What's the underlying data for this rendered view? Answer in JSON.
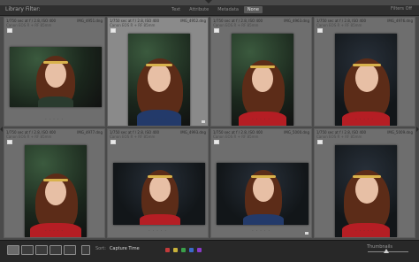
{
  "filter_bar": {
    "title": "Library Filter:",
    "tabs": [
      "Text",
      "Attribute",
      "Metadata",
      "None"
    ],
    "active_tab": "None",
    "right_label": "Filters Off"
  },
  "grid": {
    "cells": [
      {
        "meta": "1/750 sec at f / 2.8, ISO 400",
        "file": "IMG_4951.dng",
        "sub": "Canon EOS R + RF 85mm",
        "orientation": "landscape",
        "selected": false
      },
      {
        "meta": "1/750 sec at f / 2.8, ISO 400",
        "file": "IMG_4952.dng",
        "sub": "Canon EOS R + RF 85mm",
        "orientation": "portrait",
        "selected": true
      },
      {
        "meta": "1/750 sec at f / 2.8, ISO 400",
        "file": "IMG_4963.dng",
        "sub": "Canon EOS R + RF 85mm",
        "orientation": "portrait",
        "selected": false
      },
      {
        "meta": "1/750 sec at f / 2.8, ISO 400",
        "file": "IMG_4976.dng",
        "sub": "Canon EOS R + RF 85mm",
        "orientation": "portrait",
        "selected": false
      },
      {
        "meta": "1/750 sec at f / 2.8, ISO 400",
        "file": "IMG_4977.dng",
        "sub": "Canon EOS R + RF 85mm",
        "orientation": "portrait",
        "selected": false
      },
      {
        "meta": "1/750 sec at f / 2.8, ISO 400",
        "file": "IMG_4993.dng",
        "sub": "Canon EOS R + RF 85mm",
        "orientation": "landscape",
        "selected": false
      },
      {
        "meta": "1/750 sec at f / 2.8, ISO 400",
        "file": "IMG_5000.dng",
        "sub": "Canon EOS R + RF 85mm",
        "orientation": "landscape",
        "selected": false
      },
      {
        "meta": "1/750 sec at f / 2.8, ISO 400",
        "file": "IMG_5009.dng",
        "sub": "Canon EOS R + RF 85mm",
        "orientation": "portrait",
        "selected": false
      }
    ]
  },
  "toolbar": {
    "sort_label": "Sort:",
    "sort_value": "Capture Time",
    "thumbnails_label": "Thumbnails",
    "color_labels": [
      "#c33a3a",
      "#c9b23a",
      "#3aa04a",
      "#3a6ac9",
      "#8a3ac9"
    ]
  }
}
